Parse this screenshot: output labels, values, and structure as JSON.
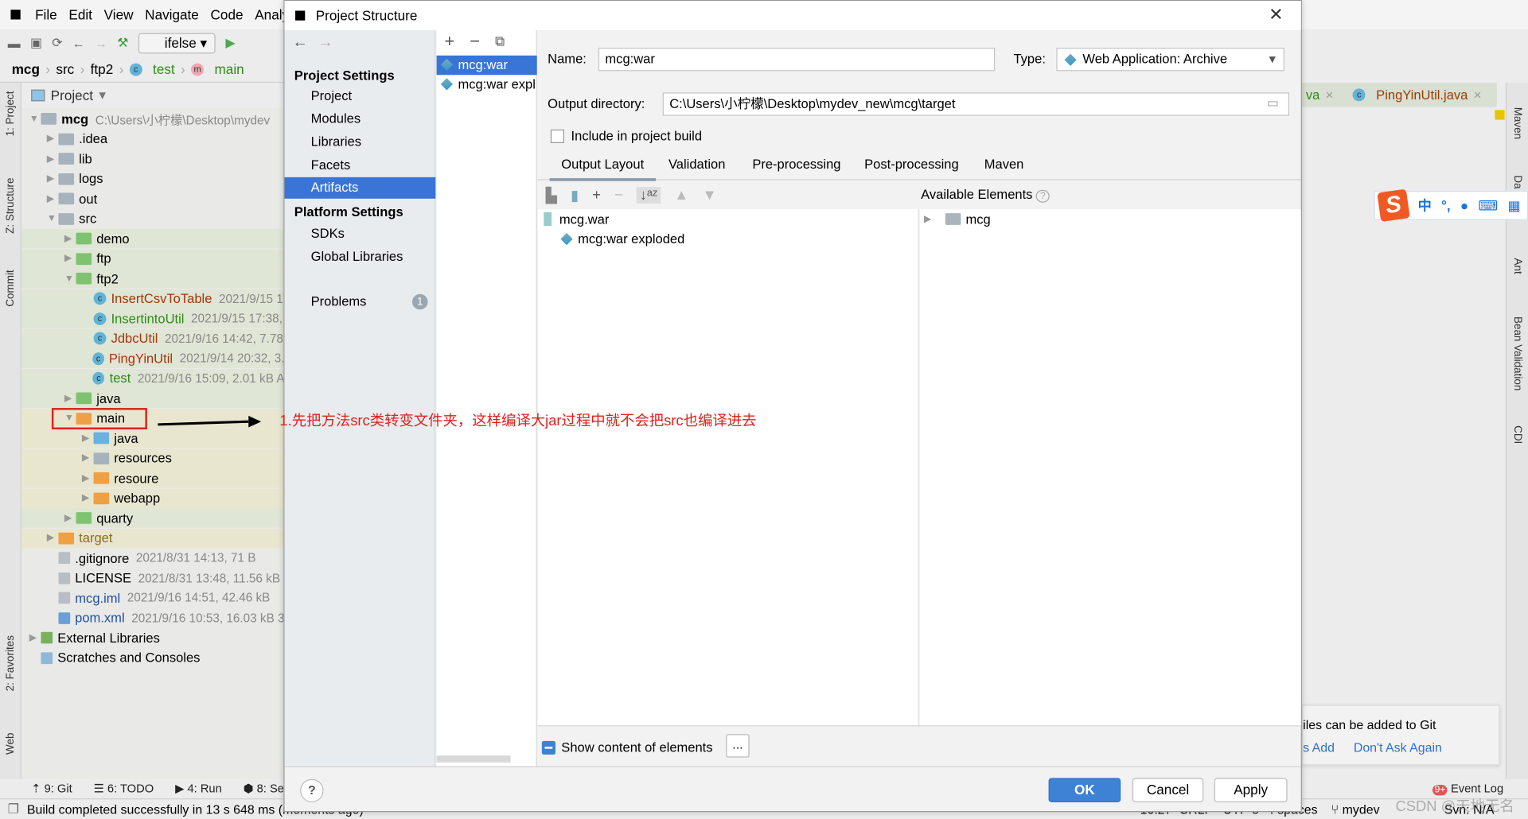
{
  "ide": {
    "menu": [
      "File",
      "Edit",
      "View",
      "Navigate",
      "Code",
      "Analy"
    ],
    "run_config": "ifelse",
    "breadcrumb": [
      "mcg",
      "src",
      "ftp2",
      "test",
      "main"
    ],
    "left_stripe": [
      "1: Project",
      "Z: Structure",
      "Commit",
      "2: Favorites",
      "Web"
    ],
    "right_stripe": [
      "Maven",
      "Da",
      "Ant",
      "Bean Validation",
      "CDI"
    ],
    "project_panel_title": "Project",
    "tree": [
      {
        "d": 0,
        "a": "down",
        "i": "module",
        "n": "mcg",
        "m": "C:\\Users\\小柠檬\\Desktop\\mydev",
        "b": true
      },
      {
        "d": 1,
        "a": "right",
        "i": "folder",
        "n": ".idea"
      },
      {
        "d": 1,
        "a": "right",
        "i": "folder",
        "n": "lib"
      },
      {
        "d": 1,
        "a": "right",
        "i": "folder",
        "n": "logs"
      },
      {
        "d": 1,
        "a": "right",
        "i": "folder",
        "n": "out"
      },
      {
        "d": 1,
        "a": "down",
        "i": "folder",
        "n": "src"
      },
      {
        "d": 2,
        "a": "right",
        "i": "gfolder",
        "n": "demo",
        "h": "g"
      },
      {
        "d": 2,
        "a": "right",
        "i": "gfolder",
        "n": "ftp",
        "h": "g"
      },
      {
        "d": 2,
        "a": "down",
        "i": "gfolder",
        "n": "ftp2",
        "h": "g"
      },
      {
        "d": 3,
        "i": "class-run",
        "n": "InsertCsvToTable",
        "m": "2021/9/15 1",
        "c": "#a3350a",
        "h": "g"
      },
      {
        "d": 3,
        "i": "class",
        "n": "InsertintoUtil",
        "m": "2021/9/15 17:38,",
        "c": "#2f8a17",
        "h": "g"
      },
      {
        "d": 3,
        "i": "class",
        "n": "JdbcUtil",
        "m": "2021/9/16 14:42, 7.78",
        "c": "#a3350a",
        "h": "g"
      },
      {
        "d": 3,
        "i": "class",
        "n": "PingYinUtil",
        "m": "2021/9/14 20:32, 3.",
        "c": "#a3350a",
        "h": "g"
      },
      {
        "d": 3,
        "i": "class-run",
        "n": "test",
        "m": "2021/9/16 15:09, 2.01 kB A",
        "c": "#2f8a17",
        "h": "g"
      },
      {
        "d": 2,
        "a": "right",
        "i": "gfolder",
        "n": "java",
        "h": "g"
      },
      {
        "d": 2,
        "a": "down",
        "i": "ofolder",
        "n": "main",
        "h": "y"
      },
      {
        "d": 3,
        "a": "right",
        "i": "bfolder",
        "n": "java",
        "h": "y"
      },
      {
        "d": 3,
        "a": "right",
        "i": "rfolder",
        "n": "resources",
        "h": "y"
      },
      {
        "d": 3,
        "a": "right",
        "i": "ofolder",
        "n": "resoure",
        "h": "y"
      },
      {
        "d": 3,
        "a": "right",
        "i": "ofolder",
        "n": "webapp",
        "h": "y"
      },
      {
        "d": 2,
        "a": "right",
        "i": "gfolder",
        "n": "quarty",
        "h": "g"
      },
      {
        "d": 1,
        "a": "right",
        "i": "ofolder",
        "n": "target",
        "c": "#8a6d1e",
        "h": "y"
      },
      {
        "d": 1,
        "i": "file",
        "n": ".gitignore",
        "m": "2021/8/31 14:13, 71 B"
      },
      {
        "d": 1,
        "i": "file",
        "n": "LICENSE",
        "m": "2021/8/31 13:48, 11.56 kB"
      },
      {
        "d": 1,
        "i": "file",
        "n": "mcg.iml",
        "m": "2021/9/16 14:51, 42.46 kB",
        "c": "#1f4fa8"
      },
      {
        "d": 1,
        "i": "maven",
        "n": "pom.xml",
        "m": "2021/9/16 10:53, 16.03 kB 3",
        "c": "#1f4fa8"
      },
      {
        "d": 0,
        "a": "right",
        "i": "libs",
        "n": "External Libraries"
      },
      {
        "d": 0,
        "i": "scratch",
        "n": "Scratches and Consoles"
      }
    ],
    "editor_tabs": [
      "va",
      "PingYinUtil.java"
    ],
    "ime": [
      "中",
      "°,",
      "🎤",
      "⌨",
      "▦"
    ],
    "notification": {
      "text": "iles can be added to Git",
      "actions": [
        "s Add",
        "Don't Ask Again"
      ]
    },
    "tool_windows": [
      "9: Git",
      "6: TODO",
      "4: Run",
      "8: Se"
    ],
    "event_log": "Event Log",
    "event_badge": "9+",
    "status_text": "Build completed successfully in 13 s 648 ms (moments ago)",
    "status_right": [
      "10:27",
      "CRLF",
      "UTF-8",
      "4 spaces",
      "mydev",
      "Svn: N/A"
    ],
    "watermark": "CSDN @天地无名"
  },
  "dialog": {
    "title": "Project Structure",
    "project_settings_header": "Project Settings",
    "project_settings": [
      "Project",
      "Modules",
      "Libraries",
      "Facets",
      "Artifacts"
    ],
    "selected": "Artifacts",
    "platform_settings_header": "Platform Settings",
    "platform_settings": [
      "SDKs",
      "Global Libraries"
    ],
    "problems": "Problems",
    "problems_count": "1",
    "artifacts": [
      "mcg:war",
      "mcg:war expl"
    ],
    "name_label": "Name:",
    "name_value": "mcg:war",
    "type_label": "Type:",
    "type_value": "Web Application: Archive",
    "output_dir_label": "Output directory:",
    "output_dir_value": "C:\\Users\\小柠檬\\Desktop\\mydev_new\\mcg\\target",
    "include_build": "Include in project build",
    "include_build_checked": false,
    "tabs": [
      "Output Layout",
      "Validation",
      "Pre-processing",
      "Post-processing",
      "Maven"
    ],
    "active_tab": "Output Layout",
    "layout_tree": [
      "mcg.war",
      "mcg:war exploded"
    ],
    "available_elements": "Available Elements",
    "available_tree": [
      "mcg"
    ],
    "show_content": "Show content of elements",
    "show_content_checked": true,
    "ellipsis": "...",
    "ok": "OK",
    "cancel": "Cancel",
    "apply": "Apply"
  },
  "annotation": {
    "text": "1.先把方法src类转变文件夹，这样编译大jar过程中就不会把src也编译进去",
    "color": "#e0201c"
  }
}
